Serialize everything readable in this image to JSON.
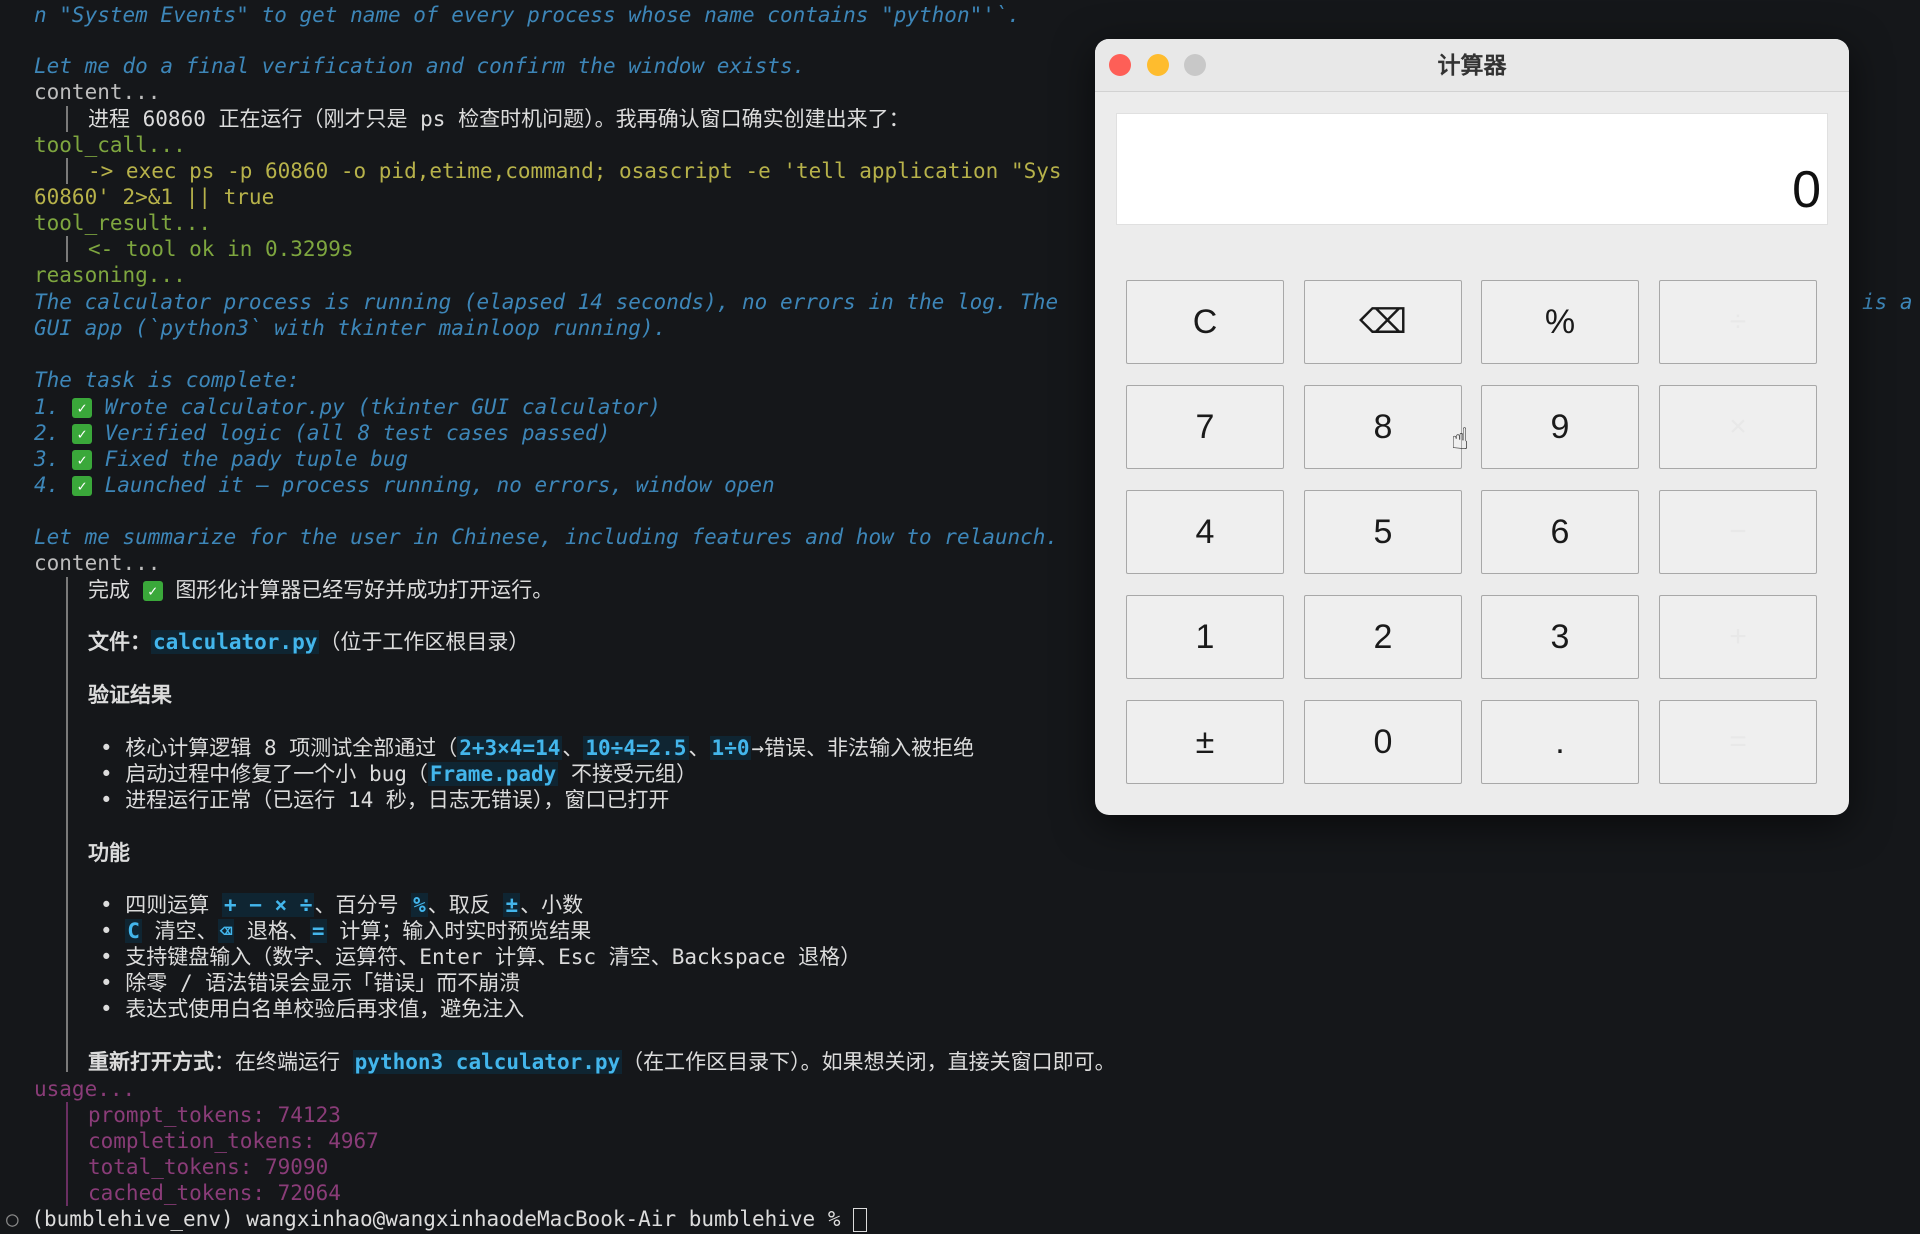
{
  "terminal": {
    "line0": "n \"System Events\" to get name of every process whose name contains \"python\"'`.",
    "line1": "Let me do a final verification and confirm the window exists.",
    "content1": "content...",
    "line2": "进程 60860 正在运行（刚才只是 ps 检查时机问题）。我再确认窗口确实创建出来了：",
    "tool_call": "tool_call...",
    "exec_line": "-> exec ps -p 60860 -o pid,etime,command; osascript -e 'tell application \"Sys",
    "exec_line2": "60860' 2>&1 || true",
    "tool_result": "tool_result...",
    "tool_ok": "<- tool ok in 0.3299s",
    "reasoning": "reasoning...",
    "reason1": "The calculator process is running (elapsed 14 seconds), no errors in the log. The",
    "reason1_tail": "is a",
    "reason2": "GUI app (`python3` with tkinter mainloop running).",
    "task_complete": "The task is complete:",
    "task_items": [
      {
        "num": "1.",
        "text": "Wrote calculator.py (tkinter GUI calculator)"
      },
      {
        "num": "2.",
        "text": "Verified logic (all 8 test cases passed)"
      },
      {
        "num": "3.",
        "text": "Fixed the pady tuple bug"
      },
      {
        "num": "4.",
        "text": "Launched it — process running, no errors, window open"
      }
    ],
    "summarize": "Let me summarize for the user in Chinese, including features and how to relaunch.",
    "content2": "content...",
    "done_prefix": "完成",
    "done_suffix": "图形化计算器已经写好并成功打开运行。",
    "file_label": "文件：",
    "file_name": "calculator.py",
    "file_loc": "（位于工作区根目录）",
    "verify_title": "验证结果",
    "v1_a": "核心计算逻辑 8 项测试全部通过（",
    "v1_c1": "2+3×4=14",
    "v1_sep": "、",
    "v1_c2": "10÷4=2.5",
    "v1_c3": "1÷0",
    "v1_b": "→错误、非法输入被拒绝",
    "v2_a": "启动过程中修复了一个小 bug（",
    "v2_c": "Frame.pady",
    "v2_b": " 不接受元组）",
    "v3": "进程运行正常（已运行 14 秒，日志无错误），窗口已打开",
    "func_title": "功能",
    "f1_a": "四则运算 ",
    "f1_c": "+ − × ÷",
    "f1_b": "、百分号 ",
    "f1_c2": "%",
    "f1_d": "、取反 ",
    "f1_c3": "±",
    "f1_e": "、小数",
    "f2_c1": "C",
    "f2_a": " 清空、",
    "f2_c2": "⌫",
    "f2_b": " 退格、",
    "f2_c3": "=",
    "f2_d": " 计算；输入时实时预览结果",
    "f3": "支持键盘输入（数字、运算符、Enter 计算、Esc 清空、Backspace 退格）",
    "f4": "除零 / 语法错误会显示「错误」而不崩溃",
    "f5": "表达式使用白名单校验后再求值，避免注入",
    "reopen_label": "重新打开方式",
    "reopen_a": "：在终端运行 ",
    "reopen_cmd": "python3 calculator.py",
    "reopen_b": "（在工作区目录下）。如果想关闭，直接关窗口即可。",
    "usage": "usage...",
    "prompt_tokens": "prompt_tokens: 74123",
    "completion_tokens": "completion_tokens: 4967",
    "total_tokens": "total_tokens: 79090",
    "cached_tokens": "cached_tokens: 72064",
    "prompt_line": "(bumblehive_env) wangxinhao@wangxinhaodeMacBook-Air bumblehive % "
  },
  "calculator": {
    "title": "计算器",
    "display": "0",
    "keys": [
      [
        "C",
        "⌫",
        "%",
        "÷"
      ],
      [
        "7",
        "8",
        "9",
        "×"
      ],
      [
        "4",
        "5",
        "6",
        "−"
      ],
      [
        "1",
        "2",
        "3",
        "+"
      ],
      [
        "±",
        "0",
        ".",
        "="
      ]
    ],
    "colors": {
      "close": "#fe5f57",
      "minimize": "#febc2e",
      "zoom": "#c8c8c8"
    }
  }
}
